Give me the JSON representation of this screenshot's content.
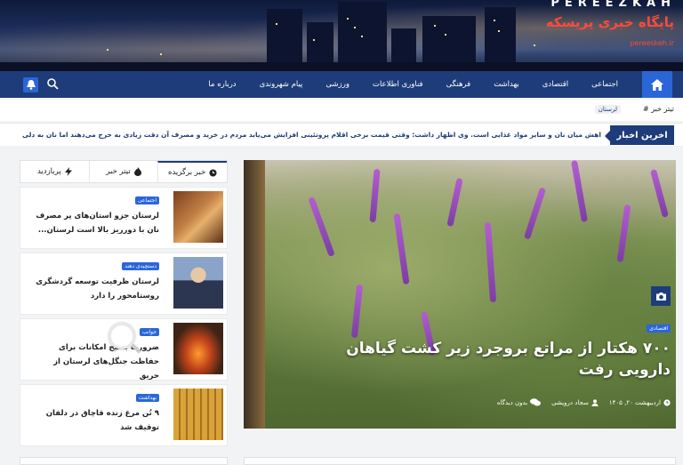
{
  "header": {
    "brand_en": "PEREEZKAH",
    "brand_fa": "پایگاه خبری پریسکه",
    "brand_url": "pereeskeh.ir"
  },
  "nav": {
    "items": [
      "اجتماعی",
      "اقتصادی",
      "بهداشت",
      "فرهنگی",
      "فناوری اطلاعات",
      "ورزشی",
      "پیام شهروندی",
      "درباره ما"
    ]
  },
  "ticker": {
    "label": "تیتر خبر",
    "tag": "لرستان"
  },
  "latest": {
    "label": "اخرین اخبار",
    "text": "اهش میان نان و سایر مواد غذایی است. وی اظهار داشت: وقتی قیمت برخی اقلام پروتئینی افزایش می‌یابد مردم در خرید و مصرف آن دقت زیادی به خرج می‌دهند اما نان به دلی"
  },
  "tabs": [
    "خبر برگزیده",
    "تیتر خبر",
    "پربازدید"
  ],
  "side_items": [
    {
      "badge": "اجتماعی",
      "title": "لرستان جزو استان‌های پر مصرف نان با دورریز بالا است لرستان..."
    },
    {
      "badge": "دستچیدی دهند",
      "title": "لرستان ظرفیت توسعه گردشگری روستامحور را دارد"
    },
    {
      "badge": "جوانب",
      "title": "ضرورت بسیج امکانات برای حفاظت جنگل‌های لرستان از حریق"
    },
    {
      "badge": "بهداشت",
      "title": "۹ تُن مرغ زنده قاچاق در دلفان توقیف شد"
    }
  ],
  "hero": {
    "badge": "اقتصادی",
    "title": "۷۰۰ هکتار از مراتع بروجرد زیر کشت گیاهان دارویی رفت",
    "date": "اردیبهشت ۲۰, ۱۴۰۵",
    "author": "سجاد درویشی",
    "comments": "بدون دیدگاه"
  }
}
